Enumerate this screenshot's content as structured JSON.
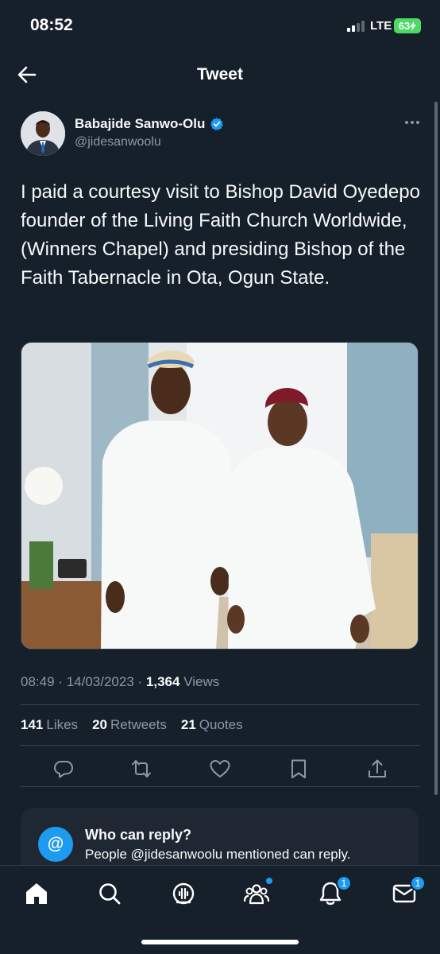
{
  "status_bar": {
    "time": "08:52",
    "network": "LTE",
    "battery": "63"
  },
  "nav": {
    "title": "Tweet",
    "back_icon": "arrow-left-icon"
  },
  "author": {
    "name": "Babajide Sanwo-Olu",
    "handle": "@jidesanwoolu",
    "verified": true
  },
  "tweet": {
    "text": "I paid a courtesy visit to Bishop David Oyedepo founder of the Living Faith Church Worldwide, (Winners Chapel) and presiding Bishop of the Faith Tabernacle in Ota, Ogun State.",
    "time": "08:49",
    "date": "14/03/2023",
    "views_count": "1,364",
    "views_label": "Views",
    "separator": "·"
  },
  "stats": {
    "likes_count": "141",
    "likes_label": "Likes",
    "retweets_count": "20",
    "retweets_label": "Retweets",
    "quotes_count": "21",
    "quotes_label": "Quotes"
  },
  "actions": [
    "reply-icon",
    "retweet-icon",
    "like-icon",
    "bookmark-icon",
    "share-icon"
  ],
  "reply_settings": {
    "icon_glyph": "@",
    "title": "Who can reply?",
    "subtitle": "People @jidesanwoolu mentioned can reply."
  },
  "tabbar": {
    "items": [
      "home-icon",
      "search-icon",
      "spaces-icon",
      "communities-icon",
      "notifications-icon",
      "messages-icon"
    ],
    "notifications_badge": "1",
    "messages_badge": "1"
  },
  "colors": {
    "background": "#15202b",
    "accent": "#1d9bf0",
    "muted": "#8b98a5",
    "text": "#f7f9f9"
  }
}
